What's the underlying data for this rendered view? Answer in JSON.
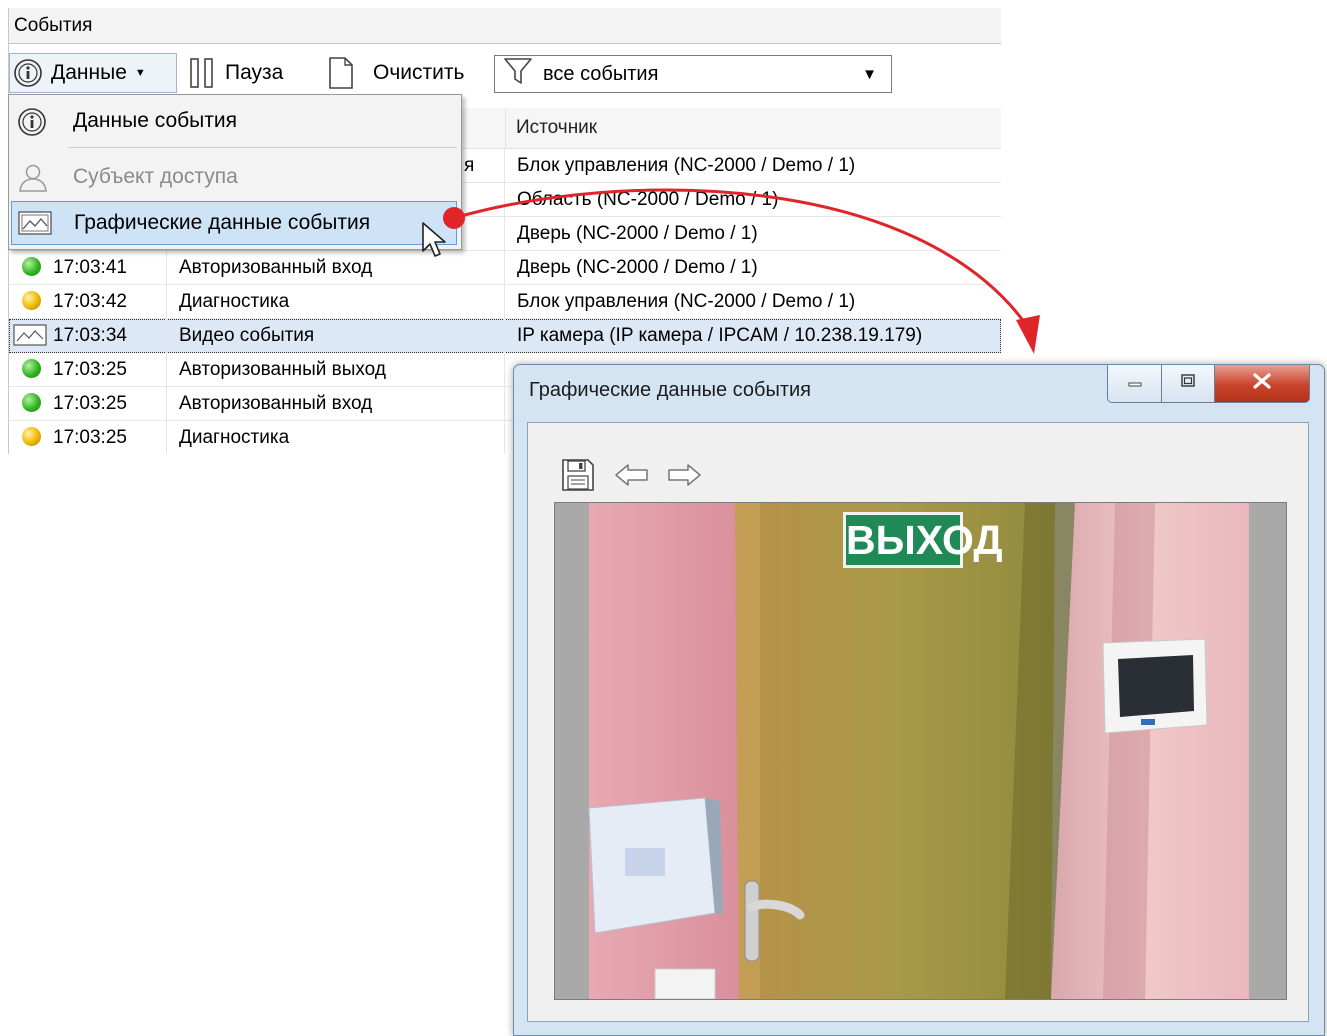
{
  "panel": {
    "title": "События"
  },
  "toolbar": {
    "data_button": "Данные",
    "pause_button": "Пауза",
    "clear_button": "Очистить",
    "filter_value": "все события"
  },
  "table": {
    "columns": {
      "source": "Источник"
    },
    "rows": [
      {
        "status": "green",
        "time": "",
        "event": "",
        "source": "Блок управления (NC-2000 / Demo / 1)",
        "tail": "я"
      },
      {
        "status": "green",
        "time": "",
        "event": "",
        "source": "Область (NC-2000 / Demo / 1)",
        "tail": ""
      },
      {
        "status": "green",
        "time": "",
        "event": "",
        "source": "Дверь (NC-2000 / Demo / 1)",
        "tail": ""
      },
      {
        "status": "green",
        "time": "17:03:41",
        "event": "Авторизованный вход",
        "source": "Дверь (NC-2000 / Demo / 1)",
        "tail": ""
      },
      {
        "status": "yellow",
        "time": "17:03:42",
        "event": "Диагностика",
        "source": "Блок управления (NC-2000 / Demo / 1)",
        "tail": ""
      },
      {
        "status": "image",
        "time": "17:03:34",
        "event": "Видео события",
        "source": "IP камера (IP камера / IPCAM / 10.238.19.179)",
        "tail": ""
      },
      {
        "status": "green",
        "time": "17:03:25",
        "event": "Авторизованный выход",
        "source": "",
        "tail": ""
      },
      {
        "status": "green",
        "time": "17:03:25",
        "event": "Авторизованный вход",
        "source": "",
        "tail": ""
      },
      {
        "status": "yellow",
        "time": "17:03:25",
        "event": "Диагностика",
        "source": "",
        "tail": ""
      }
    ]
  },
  "menu": {
    "items": [
      {
        "label": "Данные события",
        "icon": "info-icon",
        "enabled": true
      },
      {
        "label": "Субъект доступа",
        "icon": "person-icon",
        "enabled": false
      },
      {
        "label": "Графические данные события",
        "icon": "picture-icon",
        "enabled": true,
        "highlighted": true
      }
    ]
  },
  "window": {
    "title": "Графические данные события",
    "image": {
      "sign_text": "ВЫХОД"
    }
  },
  "colors": {
    "accent_red": "#e0252a",
    "menu_highlight": "#cfe3f7",
    "selected_row": "#dde8f6",
    "status_green": "#2fb520",
    "status_yellow": "#f0b400",
    "exit_sign": "#1f8a56"
  }
}
